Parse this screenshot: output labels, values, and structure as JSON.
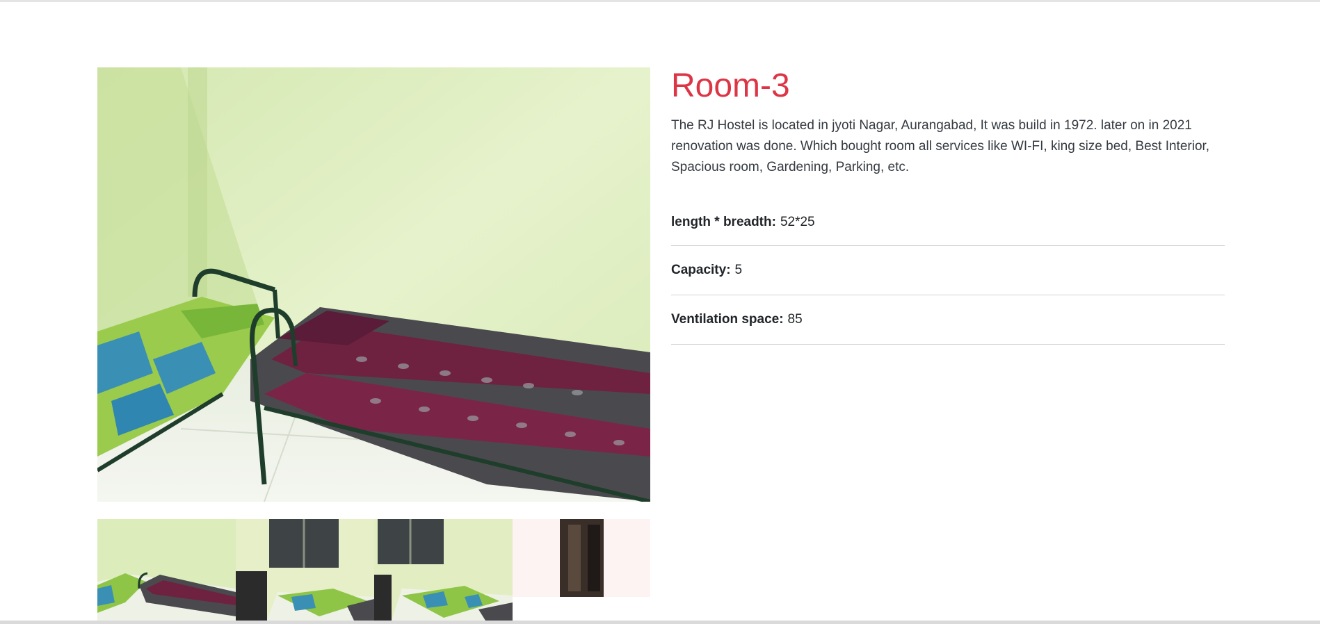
{
  "room": {
    "title": "Room-3",
    "description": "The RJ Hostel is located in jyoti Nagar, Aurangabad, It was build in 1972. later on in 2021 renovation was done. Which bought room all services like WI-FI, king size bed, Best Interior, Spacious room, Gardening, Parking, etc."
  },
  "specs": [
    {
      "label": "length * breadth:",
      "value": "52*25"
    },
    {
      "label": "Capacity:",
      "value": "5"
    },
    {
      "label": "Ventilation space:",
      "value": "85"
    }
  ],
  "colors": {
    "title": "#dc3545",
    "wall": "#dfeec0",
    "divider": "#cfd3d7"
  },
  "gallery": {
    "main_image": "room-photo-two-beds",
    "thumbnails": [
      "room-photo-two-beds",
      "room-photo-window-bed",
      "room-photo-window-bed-2",
      "room-photo-doorway"
    ]
  }
}
